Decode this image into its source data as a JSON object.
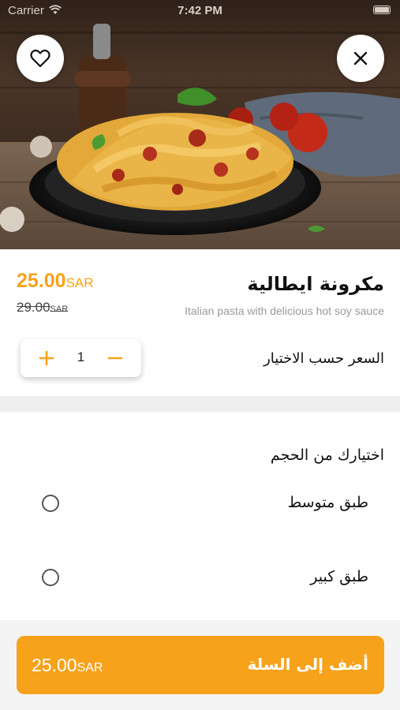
{
  "status_bar": {
    "carrier": "Carrier",
    "time": "7:42 PM"
  },
  "hero": {
    "image_description_icon": "pasta-dish-photo",
    "favorite_icon": "heart-outline-icon",
    "close_icon": "close-icon"
  },
  "product": {
    "title": "مكرونة ايطالية",
    "subtitle": "Italian pasta with delicious hot soy sauce",
    "price": "25.00",
    "currency": "SAR",
    "old_price": "29.00",
    "old_currency": "SAR",
    "quantity": "1",
    "price_by_choice_label": "السعر حسب الاختيار"
  },
  "options": {
    "title": "اختيارك من الحجم",
    "items": [
      {
        "label": "طبق متوسط",
        "selected": false
      },
      {
        "label": "طبق كبير",
        "selected": false
      }
    ]
  },
  "cart": {
    "price": "25.00",
    "currency": "SAR",
    "label": "أضف إلى السلة"
  },
  "colors": {
    "accent": "#f7a21b",
    "divider": "#efefef",
    "muted_text": "#9a9a9a"
  }
}
